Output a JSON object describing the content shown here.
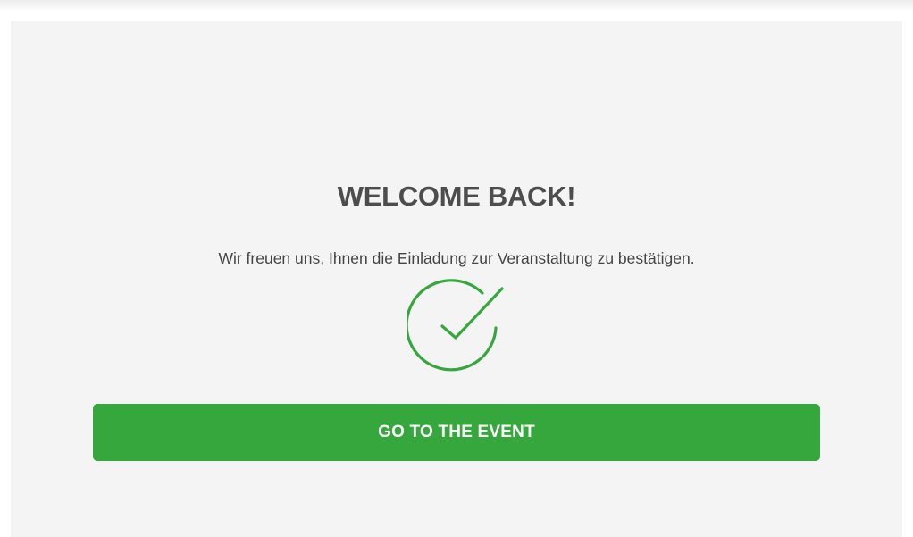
{
  "confirmation": {
    "title": "WELCOME BACK!",
    "message": "Wir freuen uns, Ihnen die Einladung zur Veranstaltung zu bestätigen.",
    "status_icon": "checkmark-circle-icon",
    "cta_label": "GO TO THE EVENT"
  },
  "colors": {
    "accent": "#35a73d",
    "card_background": "#f4f4f4",
    "title": "#4d4d4d",
    "text": "#444444"
  }
}
